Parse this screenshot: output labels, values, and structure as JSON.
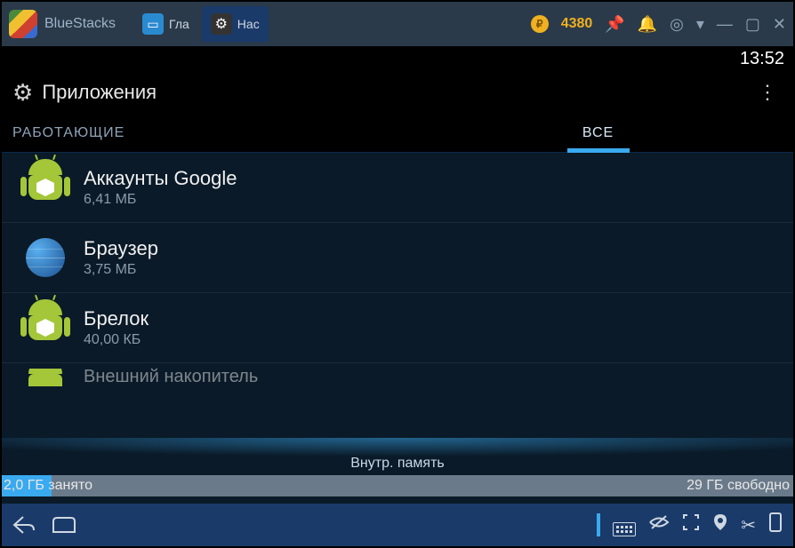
{
  "titlebar": {
    "app_name": "BlueStacks",
    "tabs": [
      {
        "label": "Гла"
      },
      {
        "label": "Нас"
      }
    ],
    "coin_count": "4380"
  },
  "status": {
    "time": "13:52"
  },
  "action_bar": {
    "title": "Приложения"
  },
  "android_tabs": {
    "working": "РАБОТАЮЩИЕ",
    "all": "ВСЕ"
  },
  "apps": [
    {
      "name": "Аккаунты Google",
      "size": "6,41 МБ",
      "icon": "android-box"
    },
    {
      "name": "Браузер",
      "size": "3,75 МБ",
      "icon": "globe"
    },
    {
      "name": "Брелок",
      "size": "40,00 КБ",
      "icon": "android-box"
    },
    {
      "name": "Внешний накопитель",
      "size": "",
      "icon": "android"
    }
  ],
  "storage": {
    "label": "Внутр. память",
    "used": "2,0 ГБ занято",
    "free": "29 ГБ свободно"
  }
}
